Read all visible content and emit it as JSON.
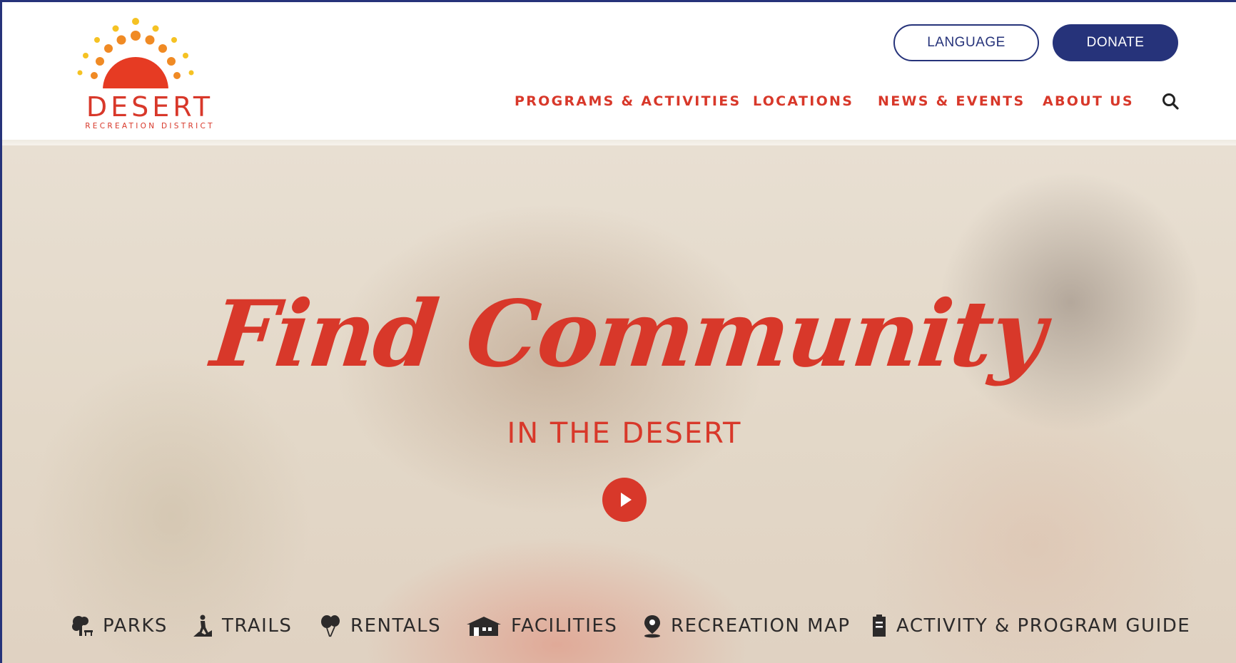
{
  "colors": {
    "brand_red": "#d8382a",
    "brand_navy": "#26337a",
    "sun_orange": "#f08a24",
    "sun_yellow": "#f5c223"
  },
  "logo": {
    "name": "DESERT",
    "tagline": "RECREATION DISTRICT",
    "icon": "sunburst-logo"
  },
  "header": {
    "language_label": "LANGUAGE",
    "donate_label": "DONATE",
    "nav": [
      {
        "label": "PROGRAMS & ACTIVITIES"
      },
      {
        "label": "LOCATIONS"
      },
      {
        "label": "NEWS & EVENTS"
      },
      {
        "label": "ABOUT US"
      }
    ],
    "search_icon": "search-icon"
  },
  "hero": {
    "title": "Find Community",
    "subtitle": "IN THE DESERT",
    "play_icon": "play-icon"
  },
  "quick_links": [
    {
      "label": "PARKS",
      "icon": "park-tree-icon"
    },
    {
      "label": "TRAILS",
      "icon": "hiker-icon"
    },
    {
      "label": "RENTALS",
      "icon": "balloons-icon"
    },
    {
      "label": "FACILITIES",
      "icon": "building-icon"
    },
    {
      "label": "RECREATION MAP",
      "icon": "map-pin-icon"
    },
    {
      "label": "ACTIVITY & PROGRAM GUIDE",
      "icon": "guide-book-icon"
    }
  ]
}
